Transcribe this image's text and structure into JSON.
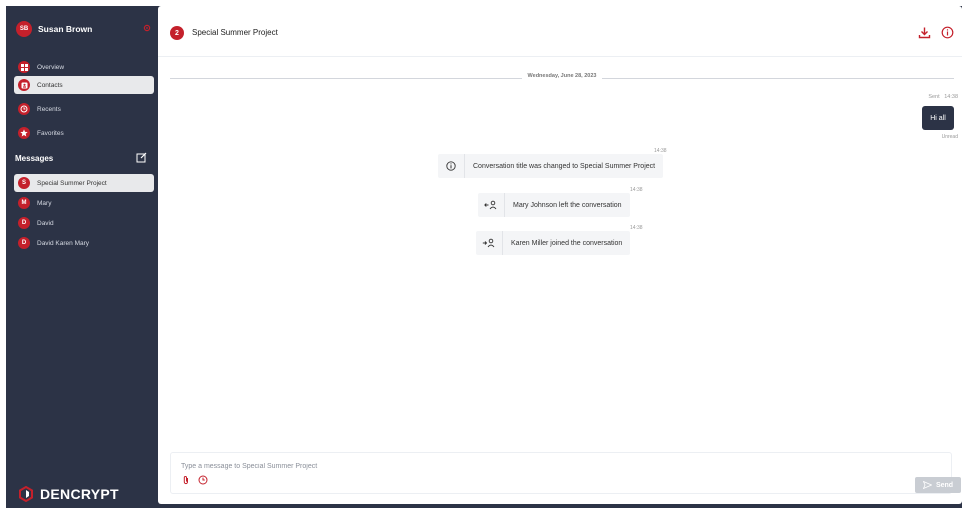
{
  "user": {
    "initials": "SB",
    "name": "Susan Brown"
  },
  "nav": [
    {
      "label": "Overview",
      "icon": "grid-icon"
    },
    {
      "label": "Contacts",
      "icon": "contacts-icon"
    },
    {
      "label": "Recents",
      "icon": "clock-icon"
    },
    {
      "label": "Favorites",
      "icon": "star-icon"
    }
  ],
  "messages_section": {
    "title": "Messages"
  },
  "conversations": [
    {
      "initial": "S",
      "name": "Special Summer Project"
    },
    {
      "initial": "M",
      "name": "Mary"
    },
    {
      "initial": "D",
      "name": "David"
    },
    {
      "initial": "D",
      "name": "David Karen Mary"
    }
  ],
  "brand": {
    "name": "DENCRYPT"
  },
  "header": {
    "badge": "2",
    "title": "Special Summer Project"
  },
  "date_separator": "Wednesday, June 28, 2023",
  "sent_message": {
    "label": "Sent",
    "time": "14:38",
    "text": "Hi all",
    "status": "Unread"
  },
  "events": [
    {
      "time": "14:38",
      "icon": "info-icon",
      "text": "Conversation title was changed to Special Summer Project"
    },
    {
      "time": "14:38",
      "icon": "user-left-icon",
      "text": "Mary Johnson left the conversation"
    },
    {
      "time": "14:38",
      "icon": "user-joined-icon",
      "text": "Karen Miller joined the conversation"
    }
  ],
  "composer": {
    "placeholder": "Type a message to Special Summer Project",
    "send_label": "Send"
  },
  "colors": {
    "sidebar": "#2c3346",
    "accent": "#c4202b",
    "send_disabled": "#c9cdd3"
  }
}
